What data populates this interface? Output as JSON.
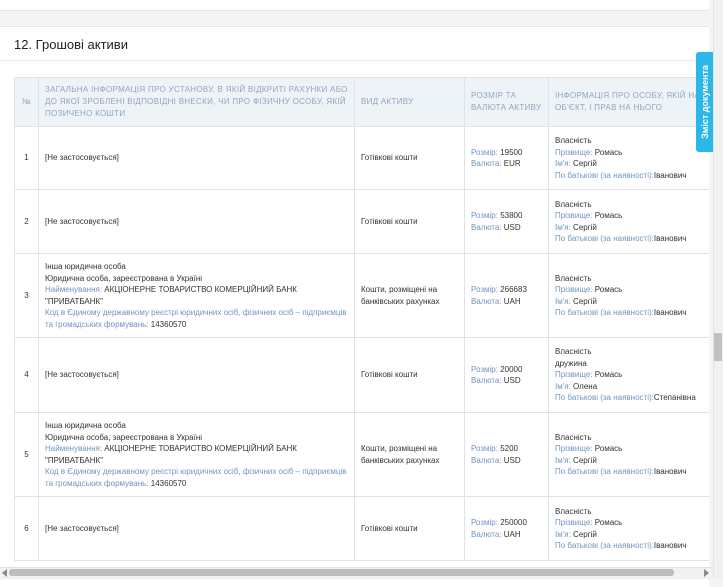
{
  "section": {
    "title": "12. Грошові активи"
  },
  "toc_tab": {
    "label": "Зміст документа"
  },
  "table": {
    "headers": {
      "num": "№",
      "institution": "Загальна інформація про установу, в якій відкриті рахунки або до якої зроблені відповідні внески, чи про фізичну особу, якій позичено кошти",
      "asset_type": "Вид активу",
      "amount": "Розмір та валюта активу",
      "owner": "Інформація про особу, якій належить об'єкт, і прав на нього"
    },
    "labels": {
      "size": "Розмір:",
      "currency": "Валюта:",
      "name": "Найменування:",
      "edrpou": "Код в Єдиному державному реєстрі юридичних осіб, фізичних осіб – підприємців та громадських формувань:",
      "surname": "Прізвище:",
      "first_name": "Ім'я:",
      "patronymic": "По батькові (за наявності):"
    },
    "rows": [
      {
        "num": "1",
        "not_applicable": "[Не застосовується]",
        "asset_type": "Готівкові кошти",
        "size": "19500",
        "currency": "EUR",
        "right": "Власність",
        "relation": "",
        "surname": "Ромась",
        "first_name": "Сергій",
        "patronymic": "Іванович"
      },
      {
        "num": "2",
        "not_applicable": "[Не застосовується]",
        "asset_type": "Готівкові кошти",
        "size": "53800",
        "currency": "USD",
        "right": "Власність",
        "relation": "",
        "surname": "Ромась",
        "first_name": "Сергій",
        "patronymic": "Іванович"
      },
      {
        "num": "3",
        "entity_kind": "Інша юридична особа",
        "entity_reg": "Юридична особа, зареєстрована в Україні",
        "entity_name": "АКЦІОНЕРНЕ ТОВАРИСТВО КОМЕРЦІЙНИЙ БАНК \"ПРИВАТБАНК\"",
        "entity_code": "14360570",
        "asset_type": "Кошти, розміщені на банківських рахунках",
        "size": "266683",
        "currency": "UAH",
        "right": "Власність",
        "relation": "",
        "surname": "Ромась",
        "first_name": "Сергій",
        "patronymic": "Іванович"
      },
      {
        "num": "4",
        "not_applicable": "[Не застосовується]",
        "asset_type": "Готівкові кошти",
        "size": "20000",
        "currency": "USD",
        "right": "Власність",
        "relation": "дружина",
        "surname": "Ромась",
        "first_name": "Олена",
        "patronymic": "Степанівна"
      },
      {
        "num": "5",
        "entity_kind": "Інша юридична особа",
        "entity_reg": "Юридична особа, зареєстрована в Україні",
        "entity_name": "АКЦІОНЕРНЕ ТОВАРИСТВО КОМЕРЦІЙНИЙ БАНК \"ПРИВАТБАНК\"",
        "entity_code": "14360570",
        "asset_type": "Кошти, розміщені на банківських рахунках",
        "size": "5200",
        "currency": "USD",
        "right": "Власність",
        "relation": "",
        "surname": "Ромась",
        "first_name": "Сергій",
        "patronymic": "Іванович"
      },
      {
        "num": "6",
        "not_applicable": "[Не застосовується]",
        "asset_type": "Готівкові кошти",
        "size": "250000",
        "currency": "UAH",
        "right": "Власність",
        "relation": "",
        "surname": "Ромась",
        "first_name": "Сергій",
        "patronymic": "Іванович"
      }
    ]
  }
}
